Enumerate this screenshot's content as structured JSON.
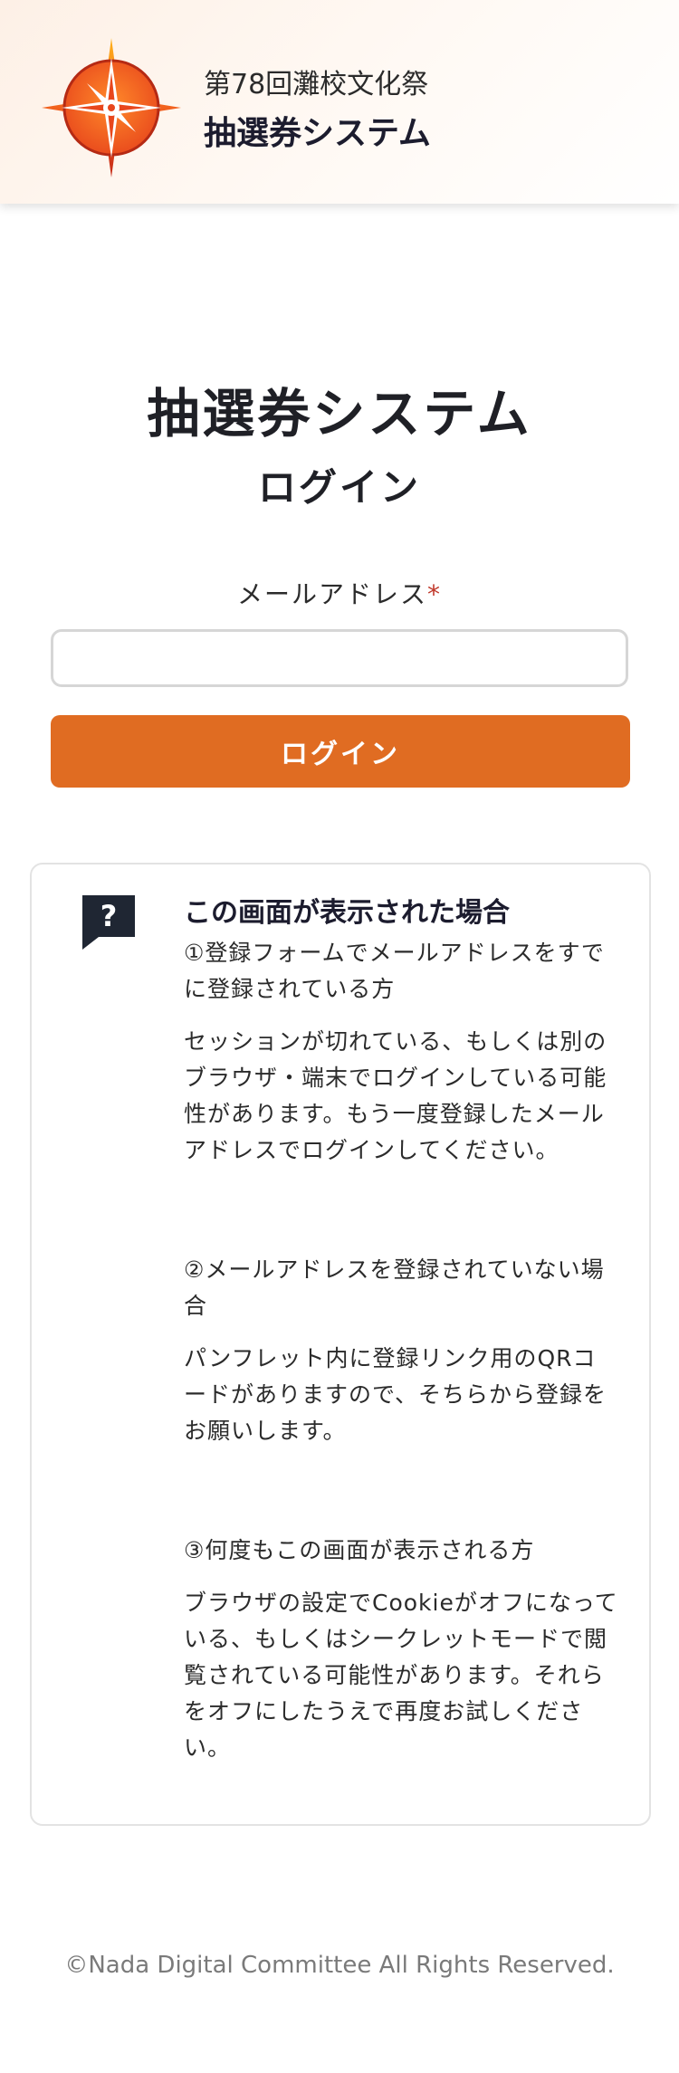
{
  "header": {
    "event_name": "第78回灘校文化祭",
    "system_name": "抽選券システム",
    "logo_icon": "compass-star-logo"
  },
  "main": {
    "title": "抽選券システム",
    "subtitle": "ログイン",
    "email_label": "メールアドレス",
    "required_mark": "*",
    "email_value": "",
    "email_placeholder": "",
    "login_button": "ログイン"
  },
  "help": {
    "icon": "question-speech-bubble-icon",
    "title": "この画面が表示された場合",
    "items": [
      {
        "heading": "①登録フォームでメールアドレスをすでに登録されている方",
        "body": "セッションが切れている、もしくは別のブラウザ・端末でログインしている可能性があります。もう一度登録したメールアドレスでログインしてください。"
      },
      {
        "heading": "②メールアドレスを登録されていない場合",
        "body": "パンフレット内に登録リンク用のQRコードがありますので、そちらから登録をお願いします。"
      },
      {
        "heading": "③何度もこの画面が表示される方",
        "body": "ブラウザの設定でCookieがオフになっている、もしくはシークレットモードで閲覧されている可能性があります。それらをオフにしたうえで再度お試しください。"
      }
    ]
  },
  "footer": {
    "copyright": "©Nada Digital Committee All Rights Reserved."
  },
  "colors": {
    "accent": "#e06c22",
    "required": "#c0392b",
    "text_dark": "#1c1c2e"
  }
}
